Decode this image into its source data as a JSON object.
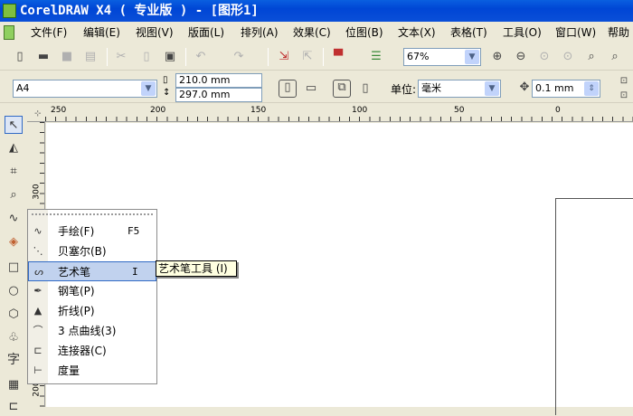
{
  "title": "CorelDRAW X4 ( 专业版 ) - [图形1]",
  "menu": [
    "文件(F)",
    "编辑(E)",
    "视图(V)",
    "版面(L)",
    "排列(A)",
    "效果(C)",
    "位图(B)",
    "文本(X)",
    "表格(T)",
    "工具(O)",
    "窗口(W)",
    "帮助"
  ],
  "toolbar": {
    "zoom": "67%"
  },
  "property_bar": {
    "paper": "A4",
    "width": "210.0 mm",
    "height": "297.0 mm",
    "unit_label": "单位:",
    "unit": "毫米",
    "nudge": "0.1 mm"
  },
  "ruler": {
    "h": [
      "250",
      "200",
      "150",
      "100",
      "50",
      "0"
    ],
    "v": [
      "300",
      "200"
    ]
  },
  "toolbox": {
    "text_tool": "字"
  },
  "flyout": [
    {
      "icon": "freehand-icon",
      "label": "手绘(F)",
      "shortcut": "F5"
    },
    {
      "icon": "bezier-icon",
      "label": "贝塞尔(B)",
      "shortcut": ""
    },
    {
      "icon": "artistic-media-icon",
      "label": "艺术笔",
      "shortcut": "I"
    },
    {
      "icon": "pen-icon",
      "label": "钢笔(P)",
      "shortcut": ""
    },
    {
      "icon": "polyline-icon",
      "label": "折线(P)",
      "shortcut": ""
    },
    {
      "icon": "3point-curve-icon",
      "label": "3 点曲线(3)",
      "shortcut": ""
    },
    {
      "icon": "connector-icon",
      "label": "连接器(C)",
      "shortcut": ""
    },
    {
      "icon": "dimension-icon",
      "label": "度量",
      "shortcut": ""
    }
  ],
  "tooltip": "艺术笔工具 (I)"
}
